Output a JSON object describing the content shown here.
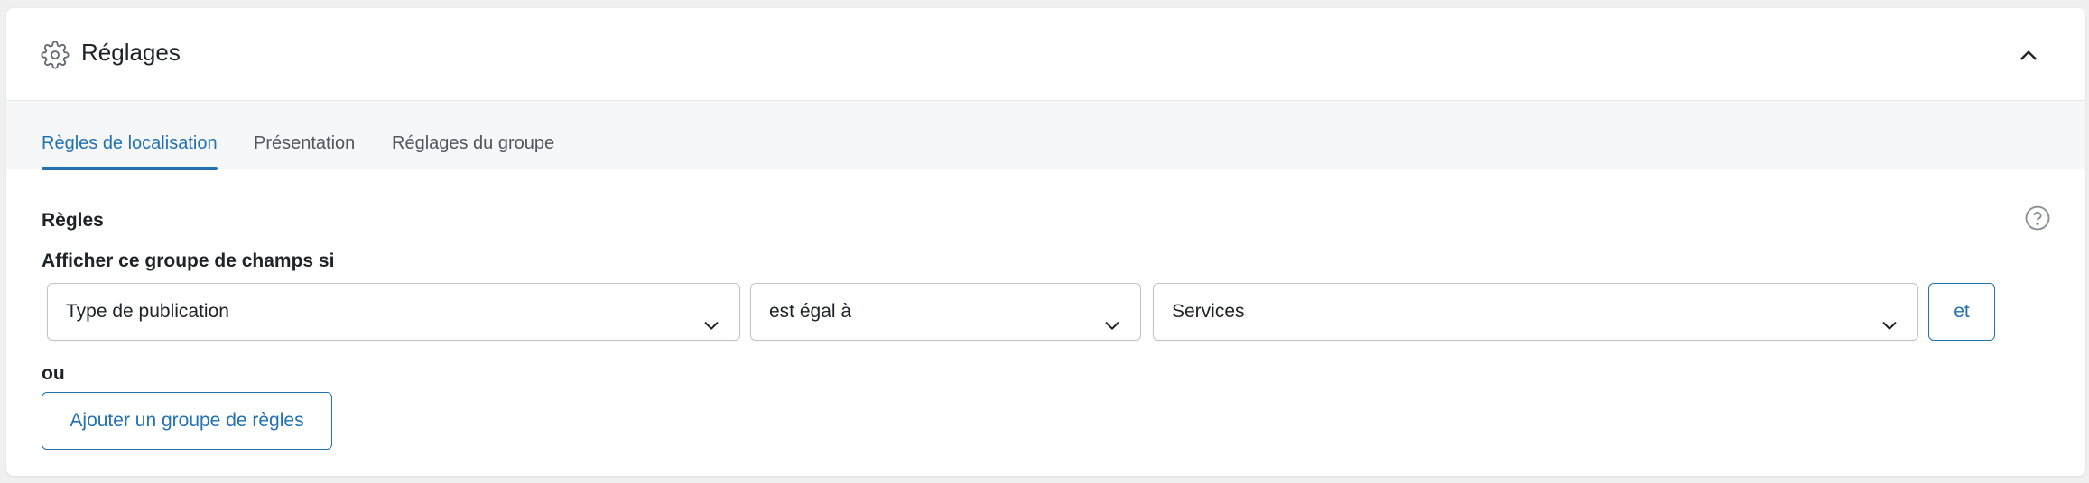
{
  "header": {
    "title": "Réglages",
    "icon": "gear-icon",
    "collapse_icon": "chevron-up-icon"
  },
  "tabs": [
    {
      "label": "Règles de localisation",
      "active": true
    },
    {
      "label": "Présentation",
      "active": false
    },
    {
      "label": "Réglages du groupe",
      "active": false
    }
  ],
  "rules": {
    "section_label": "Règles",
    "help_icon": "help-circle-icon",
    "show_if_label": "Afficher ce groupe de champs si",
    "rule": {
      "param": "Type de publication",
      "operator": "est égal à",
      "value": "Services",
      "and_label": "et"
    },
    "or_label": "ou",
    "add_group_label": "Ajouter un groupe de règles"
  },
  "colors": {
    "accent": "#2271b1",
    "text": "#1d2327",
    "muted": "#50575e",
    "tab_bar_bg": "#f6f7f9",
    "border": "#c3c4c7"
  }
}
